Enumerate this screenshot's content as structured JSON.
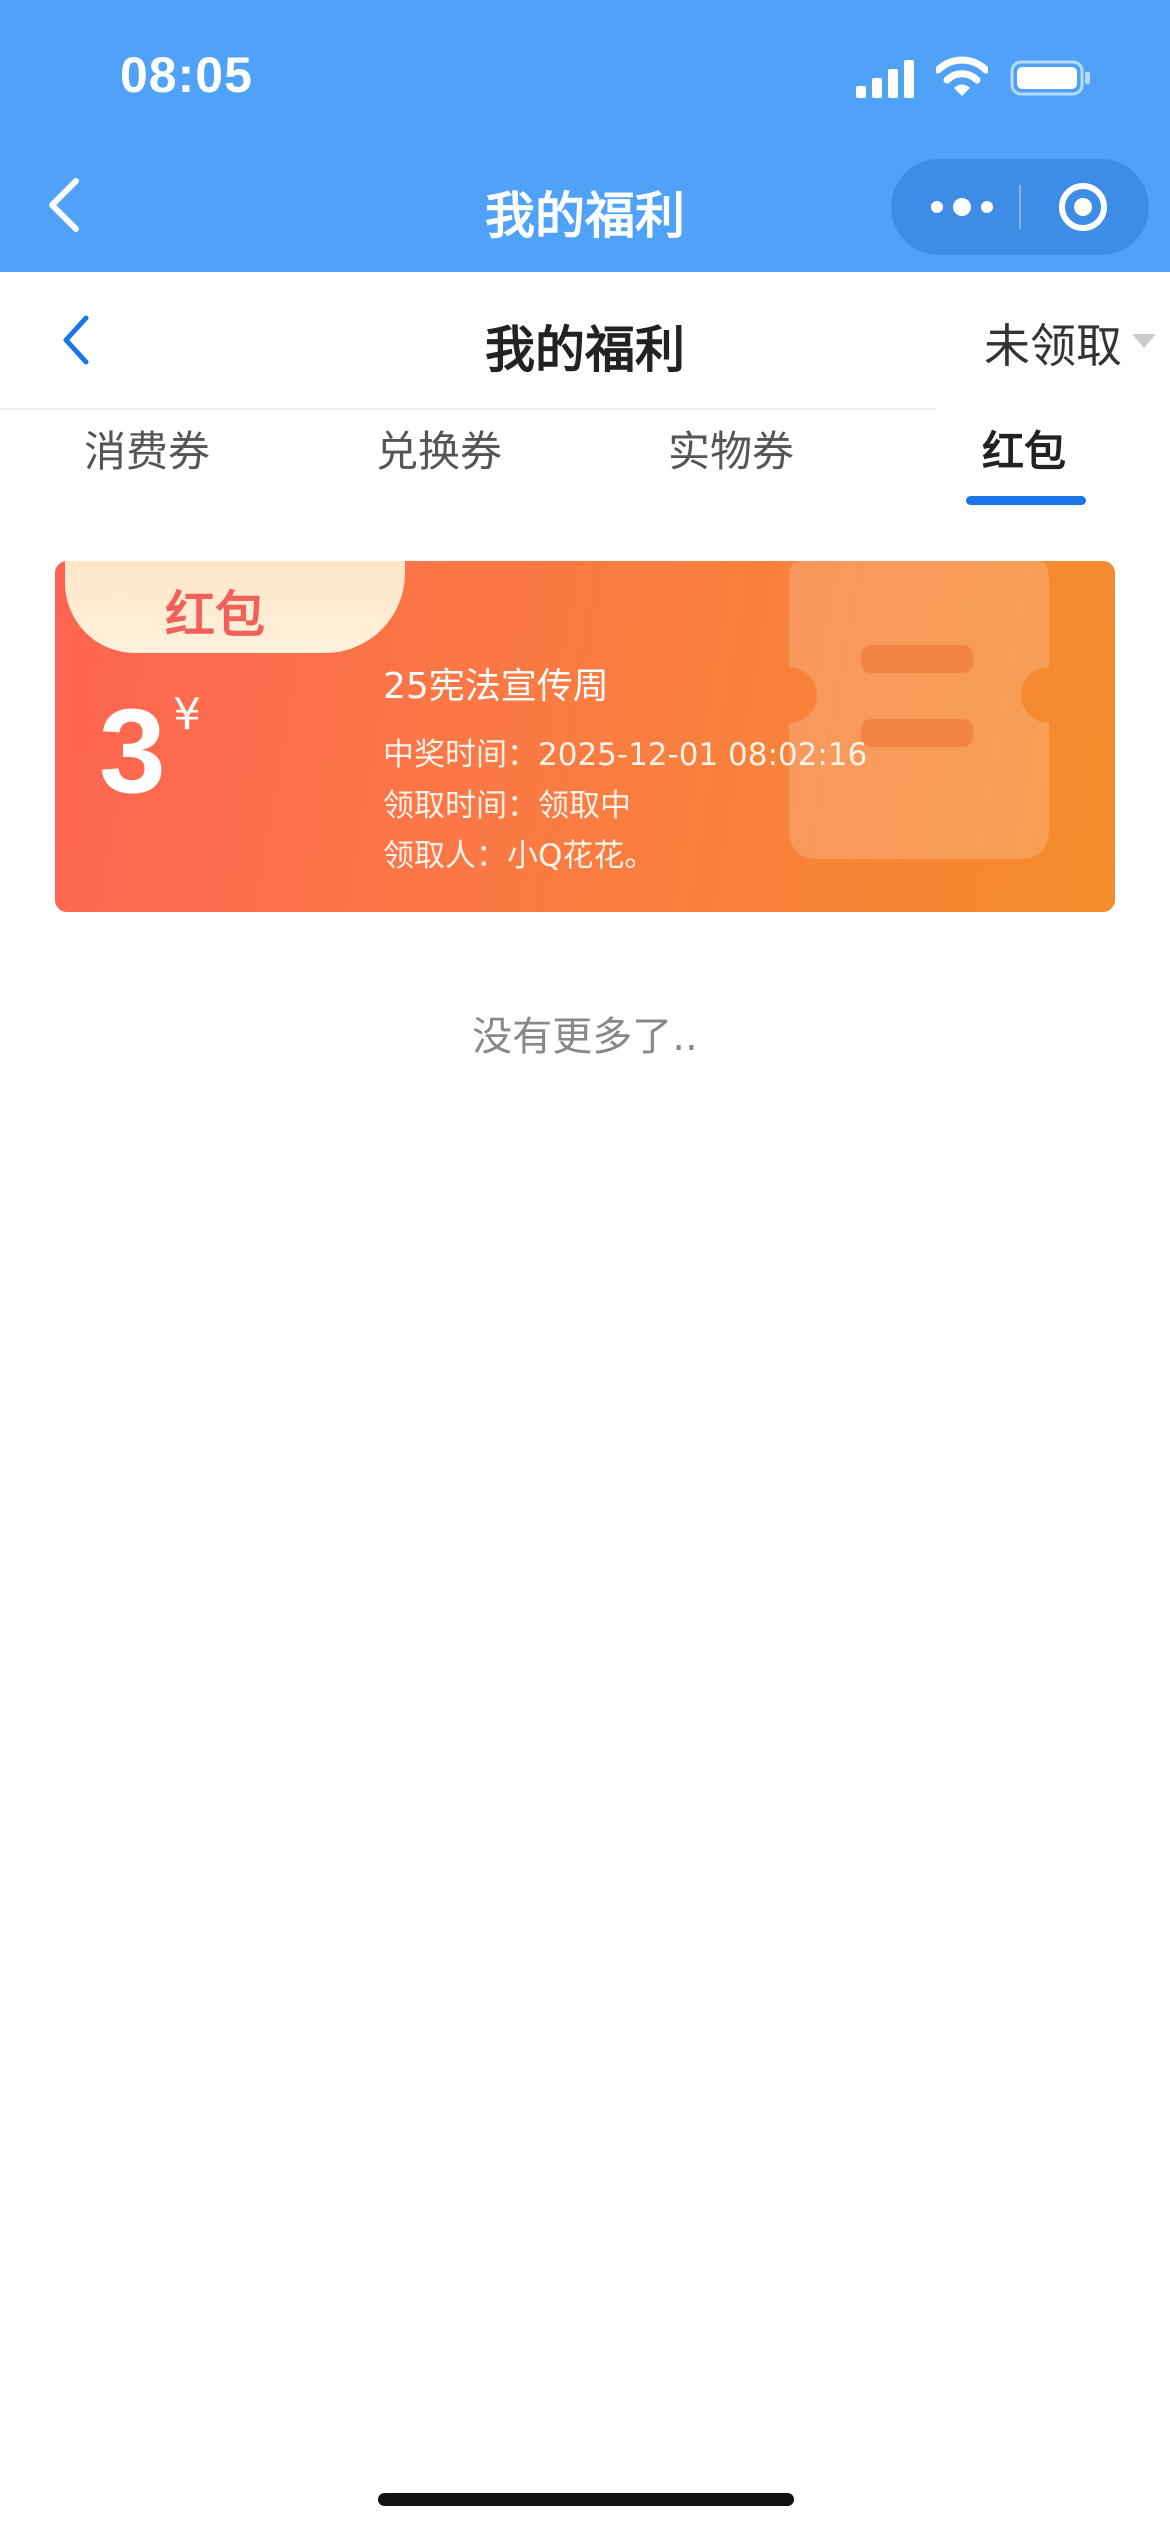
{
  "status_bar": {
    "time": "08:05"
  },
  "nav": {
    "title": "我的福利"
  },
  "sub_header": {
    "title": "我的福利",
    "filter": "未领取"
  },
  "tabs": [
    {
      "label": "消费券",
      "active": false
    },
    {
      "label": "兑换券",
      "active": false
    },
    {
      "label": "实物券",
      "active": false
    },
    {
      "label": "红包",
      "active": true
    }
  ],
  "card": {
    "badge": "红包",
    "amount": "3",
    "currency": "¥",
    "title": "25宪法宣传周",
    "rows": [
      "中奖时间：2025-12-01 08:02:16",
      "领取时间：领取中",
      "领取人：小Q花花。"
    ]
  },
  "empty_text": "没有更多了..",
  "colors": {
    "nav_bg": "#4fa2f8",
    "accent": "#1b75e8",
    "card_start": "#ff6452",
    "card_end": "#f48d2c"
  }
}
